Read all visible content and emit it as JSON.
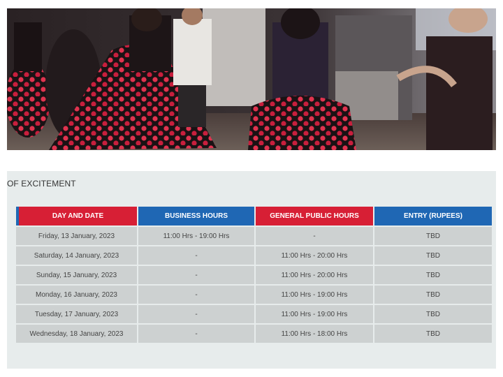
{
  "hero": {
    "icon": "dancers-photo"
  },
  "panel": {
    "heading": "OF EXCITEMENT"
  },
  "schedule": {
    "headers": [
      "DAY AND DATE",
      "BUSINESS HOURS",
      "GENERAL PUBLIC HOURS",
      "ENTRY (RUPEES)"
    ],
    "header_colors": [
      "#d71f35",
      "#1f67b4",
      "#d71f35",
      "#1f67b4"
    ],
    "rows": [
      [
        "Friday, 13 January, 2023",
        "11:00 Hrs - 19:00 Hrs",
        "-",
        "TBD"
      ],
      [
        "Saturday, 14 January, 2023",
        "-",
        "11:00 Hrs - 20:00 Hrs",
        "TBD"
      ],
      [
        "Sunday, 15 January, 2023",
        "-",
        "11:00 Hrs - 20:00 Hrs",
        "TBD"
      ],
      [
        "Monday, 16 January, 2023",
        "-",
        "11:00 Hrs - 19:00 Hrs",
        "TBD"
      ],
      [
        "Tuesday, 17 January, 2023",
        "-",
        "11:00 Hrs - 19:00 Hrs",
        "TBD"
      ],
      [
        "Wednesday, 18 January, 2023",
        "-",
        "11:00 Hrs - 18:00 Hrs",
        "TBD"
      ]
    ]
  }
}
